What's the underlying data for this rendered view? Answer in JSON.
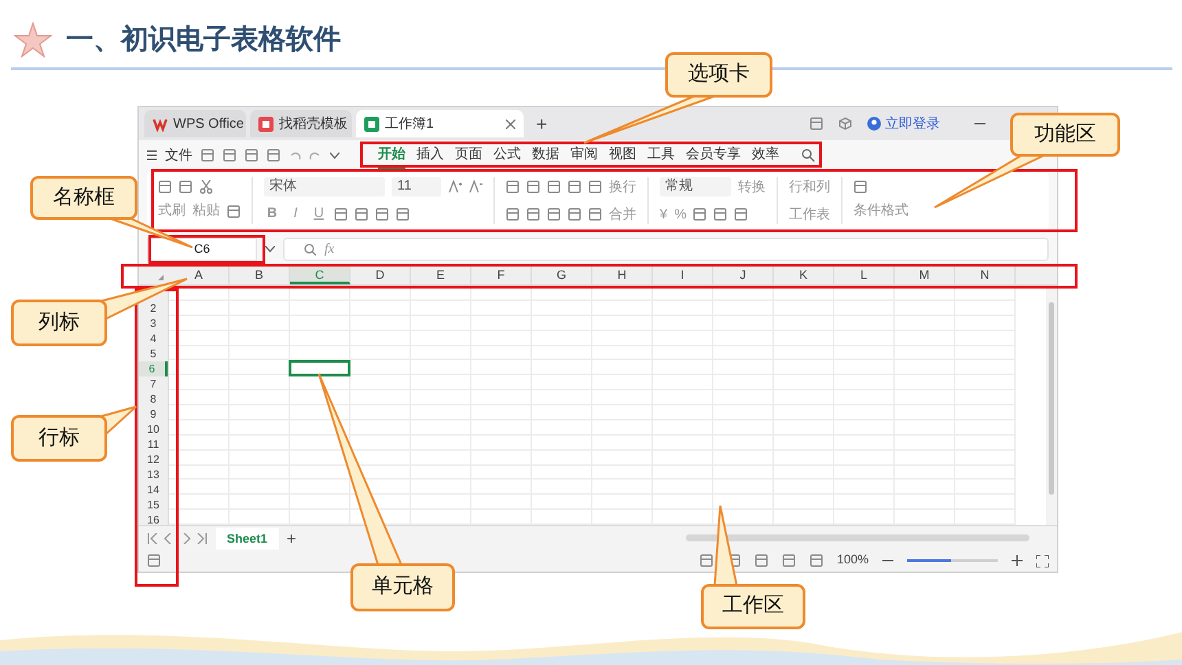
{
  "slide": {
    "title": "一、初识电子表格软件"
  },
  "app": {
    "tabs": [
      {
        "label": "WPS Office",
        "kind": "home",
        "selected": false
      },
      {
        "label": "找稻壳模板",
        "kind": "template",
        "selected": false
      },
      {
        "label": "工作簿1",
        "kind": "sheet",
        "selected": true
      }
    ],
    "new_tab": "+",
    "login": "立即登录",
    "file_menu": "文件",
    "ribbon_tabs": [
      {
        "label": "开始",
        "selected": true
      },
      {
        "label": "插入",
        "selected": false
      },
      {
        "label": "页面",
        "selected": false
      },
      {
        "label": "公式",
        "selected": false
      },
      {
        "label": "数据",
        "selected": false
      },
      {
        "label": "审阅",
        "selected": false
      },
      {
        "label": "视图",
        "selected": false
      },
      {
        "label": "工具",
        "selected": false
      },
      {
        "label": "会员专享",
        "selected": false
      },
      {
        "label": "效率",
        "selected": false
      }
    ],
    "ribbon": {
      "format_painter": "式刷",
      "paste": "粘贴",
      "font": "宋体",
      "font_size": "11",
      "format_buttons": [
        "B",
        "I",
        "U"
      ],
      "wrap": "换行",
      "merge": "合并",
      "number_format": "常规",
      "convert": "转换",
      "currency": "¥",
      "percent": "%",
      "rows_cols": "行和列",
      "worksheet": "工作表",
      "conditional": "条件格式"
    },
    "name_box": "C6",
    "formula_icon": "fx",
    "columns": [
      {
        "label": "A",
        "selected": false
      },
      {
        "label": "B",
        "selected": false
      },
      {
        "label": "C",
        "selected": true
      },
      {
        "label": "D",
        "selected": false
      },
      {
        "label": "E",
        "selected": false
      },
      {
        "label": "F",
        "selected": false
      },
      {
        "label": "G",
        "selected": false
      },
      {
        "label": "H",
        "selected": false
      },
      {
        "label": "I",
        "selected": false
      },
      {
        "label": "J",
        "selected": false
      },
      {
        "label": "K",
        "selected": false
      },
      {
        "label": "L",
        "selected": false
      },
      {
        "label": "M",
        "selected": false
      },
      {
        "label": "N",
        "selected": false
      }
    ],
    "rows": [
      {
        "label": "2",
        "selected": false
      },
      {
        "label": "3",
        "selected": false
      },
      {
        "label": "4",
        "selected": false
      },
      {
        "label": "5",
        "selected": false
      },
      {
        "label": "6",
        "selected": true
      },
      {
        "label": "7",
        "selected": false
      },
      {
        "label": "8",
        "selected": false
      },
      {
        "label": "9",
        "selected": false
      },
      {
        "label": "10",
        "selected": false
      },
      {
        "label": "11",
        "selected": false
      },
      {
        "label": "12",
        "selected": false
      },
      {
        "label": "13",
        "selected": false
      },
      {
        "label": "14",
        "selected": false
      },
      {
        "label": "15",
        "selected": false
      },
      {
        "label": "16",
        "selected": false
      }
    ],
    "sheets": [
      {
        "label": "Sheet1",
        "selected": true
      }
    ],
    "add_sheet": "+",
    "zoom": {
      "reading": "100%",
      "level": 0.49
    }
  },
  "callouts": [
    {
      "label": "选项卡"
    },
    {
      "label": "功能区"
    },
    {
      "label": "名称框"
    },
    {
      "label": "列标"
    },
    {
      "label": "行标"
    },
    {
      "label": "单元格"
    },
    {
      "label": "工作区"
    }
  ]
}
